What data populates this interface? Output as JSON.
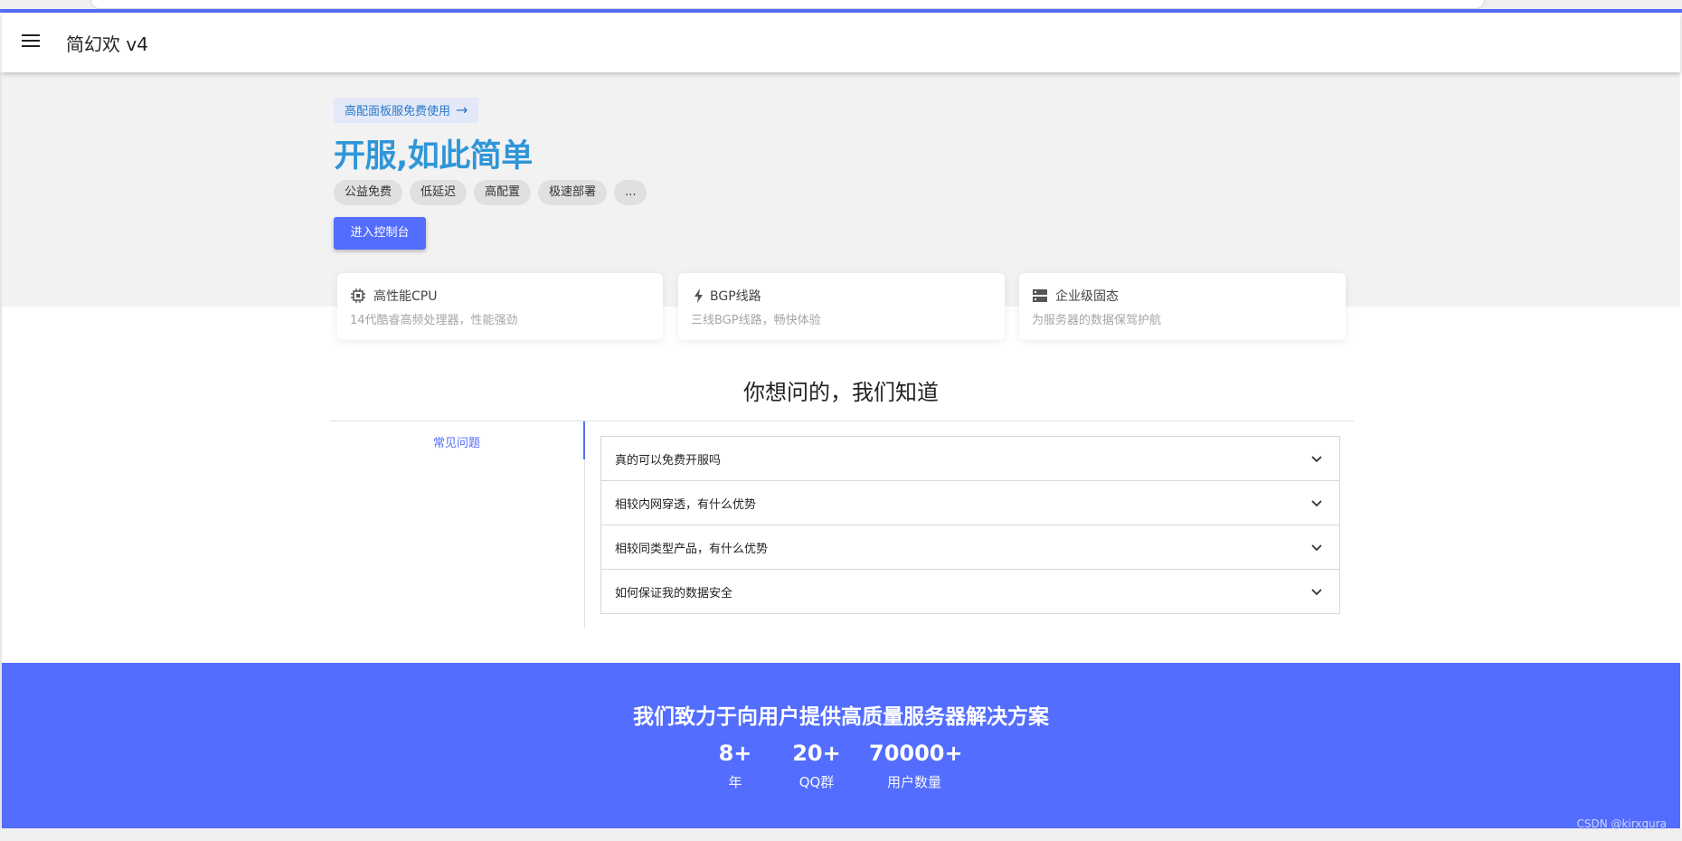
{
  "app": {
    "title": "简幻欢 v4"
  },
  "hero": {
    "promo_label": "高配面板服免费使用",
    "headline": "开服,如此简单",
    "tags": [
      "公益免费",
      "低延迟",
      "高配置",
      "极速部署",
      "..."
    ],
    "cta_label": "进入控制台"
  },
  "features": [
    {
      "icon": "cpu-icon",
      "title": "高性能CPU",
      "desc": "14代酷睿高频处理器，性能强劲"
    },
    {
      "icon": "lightning-icon",
      "title": "BGP线路",
      "desc": "三线BGP线路，畅快体验"
    },
    {
      "icon": "server-icon",
      "title": "企业级固态",
      "desc": "为服务器的数据保驾护航"
    }
  ],
  "faq": {
    "title": "你想问的，我们知道",
    "category": "常见问题",
    "items": [
      {
        "question": "真的可以免费开服吗"
      },
      {
        "question": "相较内网穿透，有什么优势"
      },
      {
        "question": "相较同类型产品，有什么优势"
      },
      {
        "question": "如何保证我的数据安全"
      }
    ]
  },
  "band": {
    "title": "我们致力于向用户提供高质量服务器解决方案",
    "stats": [
      {
        "value": "8+",
        "label": "年"
      },
      {
        "value": "20+",
        "label": "QQ群"
      },
      {
        "value": "70000+",
        "label": "用户数量"
      }
    ]
  },
  "watermark": "CSDN @kirxgura",
  "colors": {
    "accent": "#536dfe",
    "headline": "#2f96d8"
  }
}
